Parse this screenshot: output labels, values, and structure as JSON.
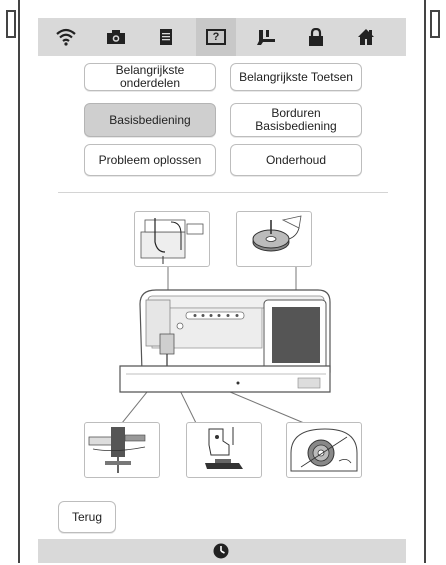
{
  "toolbar": {
    "icons": [
      "wifi-icon",
      "camera-icon",
      "document-icon",
      "help-icon",
      "presser-foot-icon",
      "lock-icon",
      "home-icon"
    ],
    "help_label": "?"
  },
  "menu": {
    "main_parts": "Belangrijkste onderdelen",
    "main_keys": "Belangrijkste Toetsen",
    "basic_operation": "Basisbediening",
    "embroidery_basic_line1": "Borduren",
    "embroidery_basic_line2": "Basisbediening",
    "troubleshooting": "Probleem oplossen",
    "maintenance": "Onderhoud"
  },
  "back": {
    "label": "Terug"
  },
  "colors": {
    "toolbar_bg": "#d9d9d9",
    "selected_bg": "#cfcfcf"
  }
}
